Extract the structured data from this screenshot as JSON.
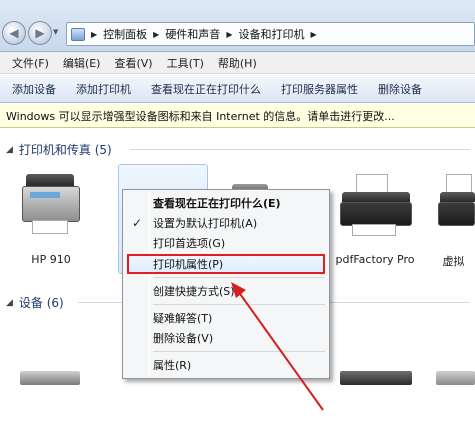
{
  "address_bar": {
    "breadcrumb": [
      "控制面板",
      "硬件和声音",
      "设备和打印机"
    ]
  },
  "menu_bar": [
    "文件(F)",
    "编辑(E)",
    "查看(V)",
    "工具(T)",
    "帮助(H)"
  ],
  "command_bar": [
    "添加设备",
    "添加打印机",
    "查看现在正在打印什么",
    "打印服务器属性",
    "删除设备"
  ],
  "info_bar": "Windows 可以显示增强型设备图标和来自 Internet 的信息。请单击进行更改...",
  "groups": {
    "printers": "打印机和传真 (5)",
    "devices": "设备 (6)"
  },
  "printers": [
    {
      "label": "HP 910"
    },
    {
      "label": ""
    },
    {
      "label": ""
    },
    {
      "label": "pdfFactory Pro"
    },
    {
      "label": "虚拟"
    }
  ],
  "context_menu": [
    {
      "label": "查看现在正在打印什么(E)",
      "bold": true
    },
    {
      "label": "设置为默认打印机(A)",
      "checked": true
    },
    {
      "label": "打印首选项(G)"
    },
    {
      "label": "打印机属性(P)",
      "highlighted": true
    },
    {
      "separator": true
    },
    {
      "label": "创建快捷方式(S)"
    },
    {
      "separator": true
    },
    {
      "label": "疑难解答(T)"
    },
    {
      "label": "删除设备(V)"
    },
    {
      "separator": true
    },
    {
      "label": "属性(R)"
    }
  ],
  "annotation_color": "#d41f1f"
}
